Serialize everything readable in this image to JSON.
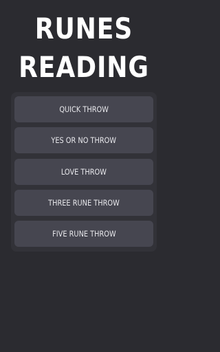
{
  "header": {
    "title_line1": "RUNES",
    "title_line2": "READING"
  },
  "menu": {
    "items": [
      {
        "label": "QUICK THROW"
      },
      {
        "label": "YES OR NO THROW"
      },
      {
        "label": "LOVE THROW"
      },
      {
        "label": "THREE RUNE THROW"
      },
      {
        "label": "FIVE RUNE THROW"
      }
    ]
  },
  "colors": {
    "background": "#2b2b30",
    "panel": "#323238",
    "button": "#464650",
    "text": "#ffffff"
  }
}
